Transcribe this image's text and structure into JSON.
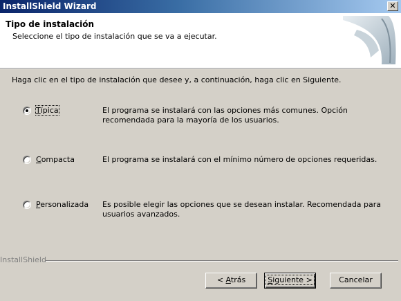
{
  "window": {
    "title": "InstallShield Wizard",
    "close_glyph": "✕"
  },
  "header": {
    "title": "Tipo de instalación",
    "subtitle": "Seleccione el tipo de instalación que se va a ejecutar."
  },
  "instruction": "Haga clic en el tipo de instalación que desee y, a continuación, haga clic en Siguiente.",
  "options": [
    {
      "mnemonic": "T",
      "label_rest": "ípica",
      "selected": true,
      "description": "El programa se instalará con las opciones más comunes.  Opción recomendada para la mayoría de los usuarios."
    },
    {
      "mnemonic": "C",
      "label_rest": "ompacta",
      "selected": false,
      "description": "El programa se instalará con el mínimo número de opciones requeridas."
    },
    {
      "mnemonic": "P",
      "label_rest": "ersonalizada",
      "selected": false,
      "description": "Es posible elegir las opciones que se desean instalar. Recomendada para usuarios avanzados."
    }
  ],
  "brand": "InstallShield",
  "buttons": {
    "back": {
      "prefix": "< ",
      "mnemonic": "A",
      "rest": "trás"
    },
    "next": {
      "mnemonic": "S",
      "rest": "iguiente >"
    },
    "cancel": "Cancelar"
  },
  "colors": {
    "title_gradient_start": "#0a246a",
    "title_gradient_end": "#a6caf0",
    "dialog_face": "#d4d0c8"
  }
}
